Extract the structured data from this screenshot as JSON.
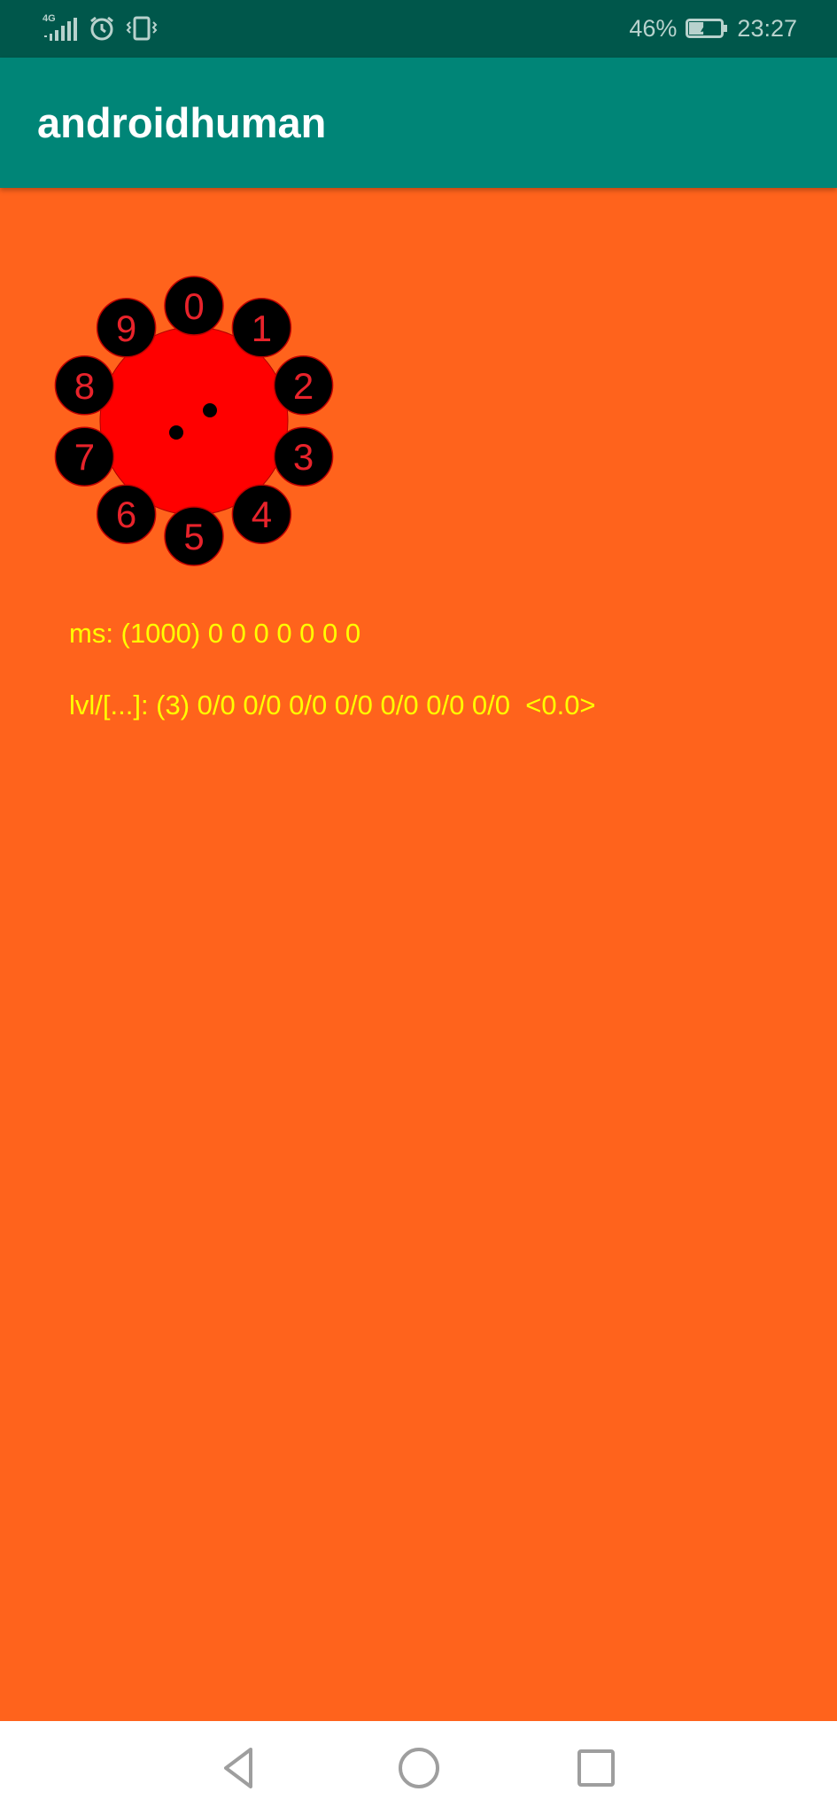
{
  "status_bar": {
    "network_type": "4G",
    "battery_percent": "46%",
    "battery_level": 0.46,
    "time": "23:27",
    "icons": [
      "signal-icon",
      "alarm-icon",
      "vibrate-icon",
      "battery-icon"
    ]
  },
  "app_bar": {
    "title": "androidhuman"
  },
  "dial": {
    "digits": [
      "0",
      "1",
      "2",
      "3",
      "4",
      "5",
      "6",
      "7",
      "8",
      "9"
    ],
    "colors": {
      "center": "#ff0000",
      "button": "#000000",
      "digit_text": "#e8232b"
    }
  },
  "stats": {
    "ms_line": "ms: (1000) 0 0 0 0 0 0 0",
    "lvl_line": "lvl/[...]: (3) 0/0 0/0 0/0 0/0 0/0 0/0 0/0  <0.0>"
  },
  "nav_bar": {
    "icons": [
      "back-icon",
      "home-icon",
      "recents-icon"
    ]
  },
  "colors": {
    "background": "#ff631c",
    "app_bar": "#008577",
    "status_bar": "#00574b",
    "info_text": "#ffff00"
  }
}
